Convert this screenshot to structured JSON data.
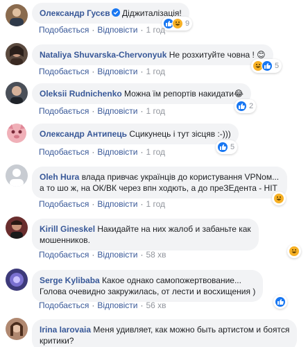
{
  "comments": [
    {
      "author": "Олександр Гусєв",
      "verified": true,
      "text": "Діджиталізація!",
      "text2": "",
      "actions": {
        "like": "Подобається",
        "reply": "Відповісти",
        "time": "1 год"
      },
      "reactions": {
        "types": [
          "like",
          "haha"
        ],
        "count": "9"
      },
      "avatar_color": "#8a6b4e"
    },
    {
      "author": "Nataliya Shuvarska-Chervonyuk",
      "verified": false,
      "text": "Не розхитуйте човна ! 😊",
      "text2": "",
      "actions": {
        "like": "Подобається",
        "reply": "Відповісти",
        "time": "1 год"
      },
      "reactions": {
        "types": [
          "haha",
          "like"
        ],
        "count": "5"
      },
      "avatar_color": "#5b4a3f"
    },
    {
      "author": "Oleksii Rudnichenko",
      "verified": false,
      "text": "Можна їм репортів накидати😂",
      "text2": "",
      "actions": {
        "like": "Подобається",
        "reply": "Відповісти",
        "time": "1 год"
      },
      "reactions": {
        "types": [
          "like"
        ],
        "count": "2"
      },
      "avatar_color": "#4a4f58"
    },
    {
      "author": "Олександр Антипець",
      "verified": false,
      "text": "Сцикунець і тут зісцяв :-)))",
      "text2": "",
      "actions": {
        "like": "Подобається",
        "reply": "Відповісти",
        "time": "1 год"
      },
      "reactions": {
        "types": [
          "like"
        ],
        "count": "5"
      },
      "avatar_color": "#f0b0b8"
    },
    {
      "author": "Oleh Hura",
      "verified": false,
      "text": "влада привчає українців до користування VPNом...",
      "text2": "а то шо ж, на ОК/ВК через впн ходють, а до преЗЕдента - НІТ",
      "actions": {
        "like": "Подобається",
        "reply": "Відповісти",
        "time": "1 год"
      },
      "reactions": {
        "types": [
          "haha"
        ],
        "count": ""
      },
      "avatar_color": "#c8ccd2"
    },
    {
      "author": "Kirill Gineskel",
      "verified": false,
      "text": "Накидайте на них жалоб и забаньте как",
      "text2": "мошенников.",
      "actions": {
        "like": "Подобається",
        "reply": "Відповісти",
        "time": "58 хв"
      },
      "reactions": {
        "types": [
          "haha"
        ],
        "count": ""
      },
      "avatar_color": "#6a2e2e"
    },
    {
      "author": "Serge Kylibaba",
      "verified": false,
      "text": "Какое однако самопожертвование...",
      "text2": "Голова очевидно закружилась, от лести и восхищения )",
      "actions": {
        "like": "Подобається",
        "reply": "Відповісти",
        "time": "56 хв"
      },
      "reactions": {
        "types": [
          "like"
        ],
        "count": ""
      },
      "avatar_color": "#3d3a7a"
    },
    {
      "author": "Irina Iarovaia",
      "verified": false,
      "text": "Меня удивляет, как можно быть артистом и боятся",
      "text2": "критики?",
      "actions": {
        "like": "",
        "reply": "",
        "time": ""
      },
      "reactions": {
        "types": [],
        "count": ""
      },
      "avatar_color": "#b08870"
    }
  ],
  "colors": {
    "link": "#385898",
    "bubble": "#f2f3f5",
    "like": "#1877f2",
    "haha": "#f7b125"
  }
}
